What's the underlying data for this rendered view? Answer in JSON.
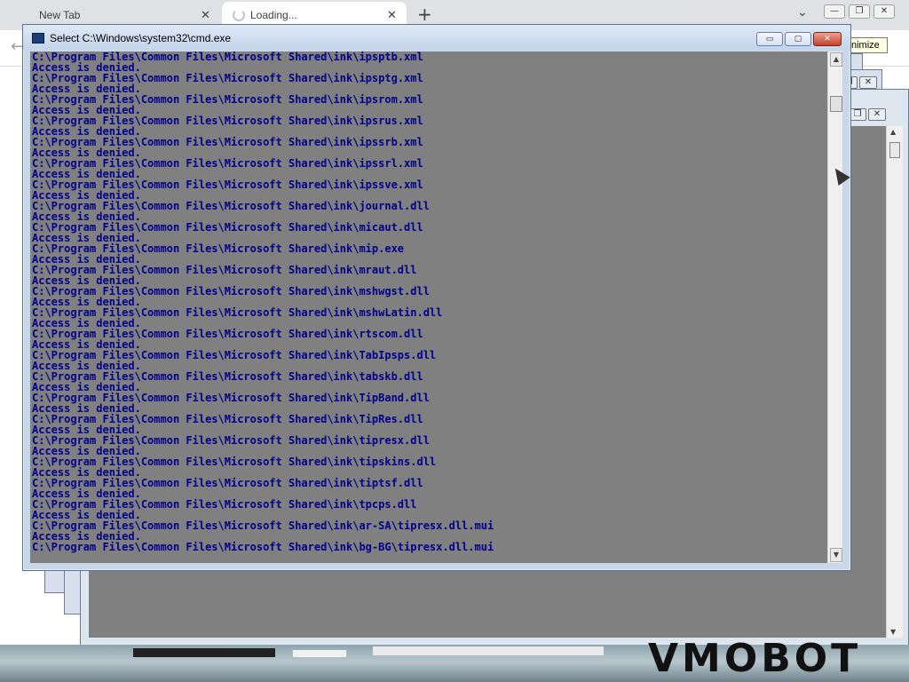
{
  "browser": {
    "tabs": [
      {
        "label": "New Tab",
        "close": "✕"
      },
      {
        "label": "Loading...",
        "close": "✕"
      }
    ],
    "new_tab_symbol": "+",
    "dropdown_symbol": "⌄",
    "back_symbol": "←",
    "tooltip": "nimize",
    "window_controls": [
      "—",
      "❐",
      "✕"
    ]
  },
  "cmd": {
    "title": "Select C:\\Windows\\system32\\cmd.exe",
    "icon": "cmd-icon",
    "buttons": {
      "min": "▭",
      "max": "▢",
      "close": "✕"
    },
    "lines": [
      "C:\\Program Files\\Common Files\\Microsoft Shared\\ink\\ipsptb.xml",
      "Access is denied.",
      "C:\\Program Files\\Common Files\\Microsoft Shared\\ink\\ipsptg.xml",
      "Access is denied.",
      "C:\\Program Files\\Common Files\\Microsoft Shared\\ink\\ipsrom.xml",
      "Access is denied.",
      "C:\\Program Files\\Common Files\\Microsoft Shared\\ink\\ipsrus.xml",
      "Access is denied.",
      "C:\\Program Files\\Common Files\\Microsoft Shared\\ink\\ipssrb.xml",
      "Access is denied.",
      "C:\\Program Files\\Common Files\\Microsoft Shared\\ink\\ipssrl.xml",
      "Access is denied.",
      "C:\\Program Files\\Common Files\\Microsoft Shared\\ink\\ipssve.xml",
      "Access is denied.",
      "C:\\Program Files\\Common Files\\Microsoft Shared\\ink\\journal.dll",
      "Access is denied.",
      "C:\\Program Files\\Common Files\\Microsoft Shared\\ink\\micaut.dll",
      "Access is denied.",
      "C:\\Program Files\\Common Files\\Microsoft Shared\\ink\\mip.exe",
      "Access is denied.",
      "C:\\Program Files\\Common Files\\Microsoft Shared\\ink\\mraut.dll",
      "Access is denied.",
      "C:\\Program Files\\Common Files\\Microsoft Shared\\ink\\mshwgst.dll",
      "Access is denied.",
      "C:\\Program Files\\Common Files\\Microsoft Shared\\ink\\mshwLatin.dll",
      "Access is denied.",
      "C:\\Program Files\\Common Files\\Microsoft Shared\\ink\\rtscom.dll",
      "Access is denied.",
      "C:\\Program Files\\Common Files\\Microsoft Shared\\ink\\TabIpsps.dll",
      "Access is denied.",
      "C:\\Program Files\\Common Files\\Microsoft Shared\\ink\\tabskb.dll",
      "Access is denied.",
      "C:\\Program Files\\Common Files\\Microsoft Shared\\ink\\TipBand.dll",
      "Access is denied.",
      "C:\\Program Files\\Common Files\\Microsoft Shared\\ink\\TipRes.dll",
      "Access is denied.",
      "C:\\Program Files\\Common Files\\Microsoft Shared\\ink\\tipresx.dll",
      "Access is denied.",
      "C:\\Program Files\\Common Files\\Microsoft Shared\\ink\\tipskins.dll",
      "Access is denied.",
      "C:\\Program Files\\Common Files\\Microsoft Shared\\ink\\tiptsf.dll",
      "Access is denied.",
      "C:\\Program Files\\Common Files\\Microsoft Shared\\ink\\tpcps.dll",
      "Access is denied.",
      "C:\\Program Files\\Common Files\\Microsoft Shared\\ink\\ar-SA\\tipresx.dll.mui",
      "Access is denied.",
      "C:\\Program Files\\Common Files\\Microsoft Shared\\ink\\bg-BG\\tipresx.dll.mui"
    ],
    "colors": {
      "console_bg": "#808080",
      "console_text": "#00008b"
    }
  },
  "wallpaper": {
    "text": "VMOBOT"
  }
}
